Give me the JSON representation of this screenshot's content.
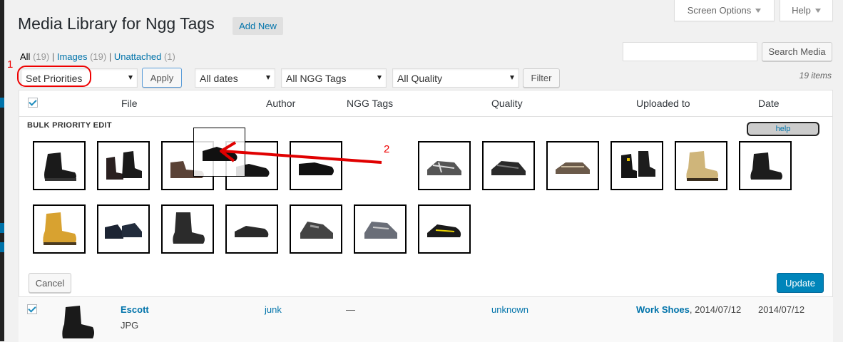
{
  "header": {
    "title": "Media Library for Ngg Tags",
    "add_new": "Add New",
    "screen_options": "Screen Options",
    "help": "Help"
  },
  "filters": {
    "all_label": "All",
    "all_count": "(19)",
    "images_label": "Images",
    "images_count": "(19)",
    "unattached_label": "Unattached",
    "unattached_count": "(1)",
    "bulk_action": "Set Priorities",
    "apply": "Apply",
    "dates": "All dates",
    "ngg_tags": "All NGG Tags",
    "quality": "All Quality",
    "filter": "Filter",
    "search_button": "Search Media",
    "search_value": "",
    "items_count": "19 items"
  },
  "table": {
    "columns": [
      "File",
      "Author",
      "NGG Tags",
      "Quality",
      "Uploaded to",
      "Date"
    ]
  },
  "bulk_edit": {
    "title": "BULK PRIORITY EDIT",
    "help": "help",
    "cancel": "Cancel",
    "update": "Update",
    "thumbnails_row1": [
      "black-boot",
      "black-boot-laced",
      "brown-shoe",
      "black-shoe",
      "black-dress-shoe",
      "grey-sandal",
      "black-sandal",
      "brown-sandal",
      "black-safety-boots",
      "tan-boot",
      "black-rigger-boot"
    ],
    "thumbnails_row2": [
      "yellow-boot",
      "navy-shoes",
      "black-high-boot",
      "black-trainer",
      "grey-hiker",
      "grey-trainer",
      "black-safety-trainer"
    ]
  },
  "annotations": {
    "marker1": "1",
    "marker2": "2",
    "accent": "#e00000"
  },
  "first_row": {
    "title": "Escott",
    "type": "JPG",
    "author": "junk",
    "tags": "—",
    "quality": "unknown",
    "uploaded_to": "Work Shoes",
    "uploaded_date": ", 2014/07/12",
    "date": "2014/07/12"
  }
}
